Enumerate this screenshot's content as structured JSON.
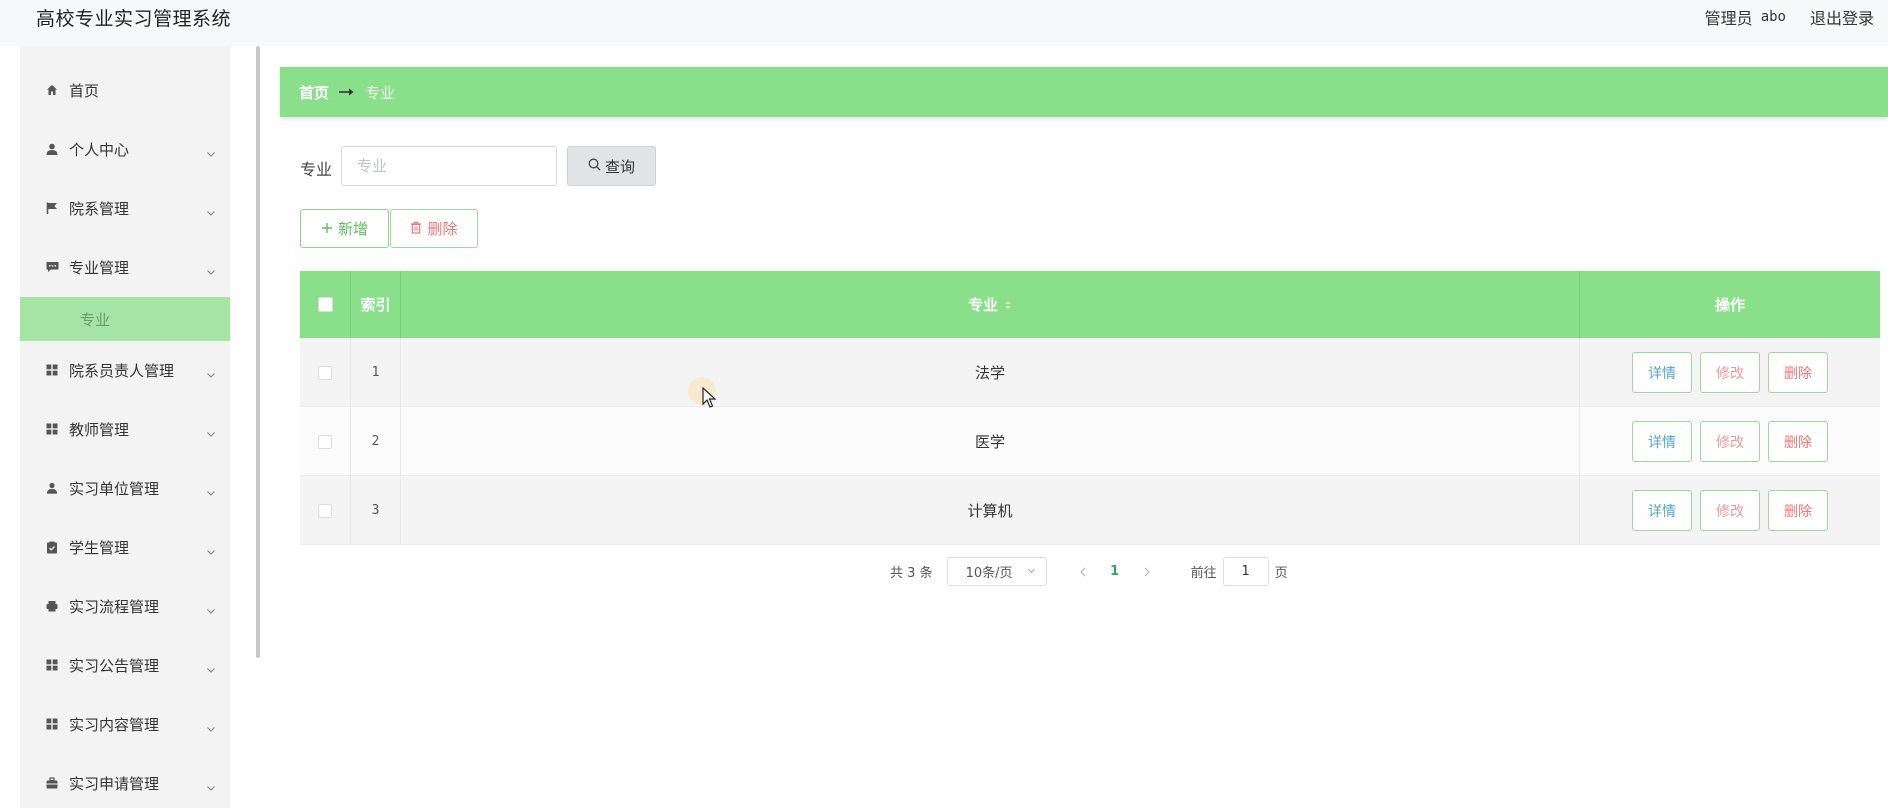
{
  "app": {
    "title": "高校专业实习管理系统",
    "user_role": "管理员",
    "user_name": "abo",
    "logout_label": "退出登录"
  },
  "colors": {
    "accent_green": "#8ae08a",
    "submenu_active": "#a6e4a6",
    "delete_red": "#e77",
    "detail_blue": "#52a8c8"
  },
  "sidebar": {
    "items": [
      {
        "label": "首页",
        "icon": "home-icon",
        "has_submenu": false
      },
      {
        "label": "个人中心",
        "icon": "user-icon",
        "has_submenu": true
      },
      {
        "label": "院系管理",
        "icon": "flag-icon",
        "has_submenu": true
      },
      {
        "label": "专业管理",
        "icon": "chat-icon",
        "has_submenu": true
      },
      {
        "label": "院系员责人管理",
        "icon": "grid-icon",
        "has_submenu": true
      },
      {
        "label": "教师管理",
        "icon": "grid-icon",
        "has_submenu": true
      },
      {
        "label": "实习单位管理",
        "icon": "person-icon",
        "has_submenu": true
      },
      {
        "label": "学生管理",
        "icon": "clipboard-icon",
        "has_submenu": true
      },
      {
        "label": "实习流程管理",
        "icon": "printer-icon",
        "has_submenu": true
      },
      {
        "label": "实习公告管理",
        "icon": "grid-icon",
        "has_submenu": true
      },
      {
        "label": "实习内容管理",
        "icon": "grid-icon",
        "has_submenu": true
      },
      {
        "label": "实习申请管理",
        "icon": "briefcase-icon",
        "has_submenu": true
      }
    ],
    "active_submenu": {
      "parent": "专业管理",
      "label": "专业"
    }
  },
  "breadcrumb": {
    "home": "首页",
    "current": "专业"
  },
  "search": {
    "label": "专业",
    "placeholder": "专业",
    "value": "",
    "button_label": "查询"
  },
  "toolbar": {
    "add_label": "新增",
    "delete_label": "删除"
  },
  "table": {
    "columns": {
      "index": "索引",
      "major": "专业",
      "operations": "操作"
    },
    "rows": [
      {
        "index": "1",
        "major": "法学"
      },
      {
        "index": "2",
        "major": "医学"
      },
      {
        "index": "3",
        "major": "计算机"
      }
    ],
    "actions": {
      "detail": "详情",
      "edit": "修改",
      "delete": "删除"
    }
  },
  "pagination": {
    "total_prefix": "共",
    "total": "3",
    "total_suffix": "条",
    "page_size": "10条/页",
    "current_page": "1",
    "goto_label": "前往",
    "goto_value": "1",
    "page_unit": "页"
  }
}
